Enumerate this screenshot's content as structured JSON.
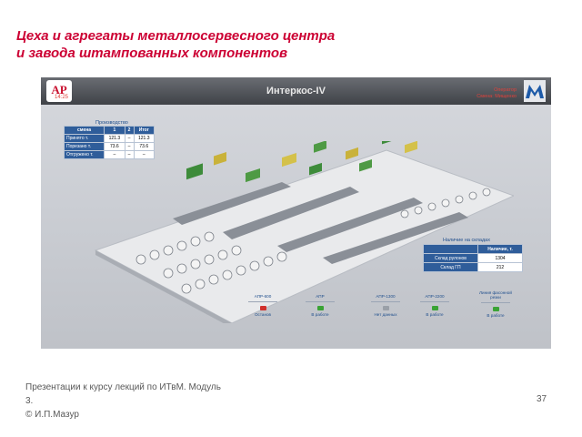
{
  "slide": {
    "title_line1": "Цеха и агрегаты металлосервесного центра",
    "title_line2": "и завода штампованных компонентов",
    "footer_line1": "Презентации к курсу лекций по ИТвМ. Модуль",
    "footer_line2": "3.",
    "footer_line3": "© И.П.Мазур",
    "page_number": "37"
  },
  "app": {
    "logo_text": "АР",
    "title": "Интеркос-IV",
    "header_left": "14:25",
    "header_right_line1": "Оператор",
    "header_right_line2": "Смена: Мищенко",
    "accent_color": "#cc0033",
    "header_color": "#4a4d52",
    "table_header_color": "#2f5d9a",
    "production": {
      "caption": "Производство",
      "columns": [
        "смена",
        "1",
        "2",
        "Итог"
      ],
      "rows": [
        {
          "label": "Принято т.",
          "values": [
            "121.3",
            "–",
            "121.3"
          ]
        },
        {
          "label": "Порезано т.",
          "values": [
            "73.6",
            "–",
            "73.6"
          ]
        },
        {
          "label": "Отгружено т.",
          "values": [
            "–",
            "–",
            "–"
          ]
        }
      ]
    },
    "stock": {
      "caption": "Наличие на складах",
      "header": "Наличие, т.",
      "rows": [
        {
          "label": "Склад рулонов",
          "value": "1304"
        },
        {
          "label": "Склад ГП",
          "value": "212"
        }
      ]
    },
    "statuses": [
      {
        "name": "АПР-600",
        "state": "Останов",
        "lamp": "red"
      },
      {
        "name": "АПР",
        "state": "В работе",
        "lamp": "green"
      },
      {
        "name": "АПР-1300",
        "state": "Нет данных",
        "lamp": "grey"
      },
      {
        "name": "АПР-2200",
        "state": "В работе",
        "lamp": "green"
      },
      {
        "name": "Линия фасонной резки",
        "state": "В работе",
        "lamp": "green"
      }
    ]
  }
}
